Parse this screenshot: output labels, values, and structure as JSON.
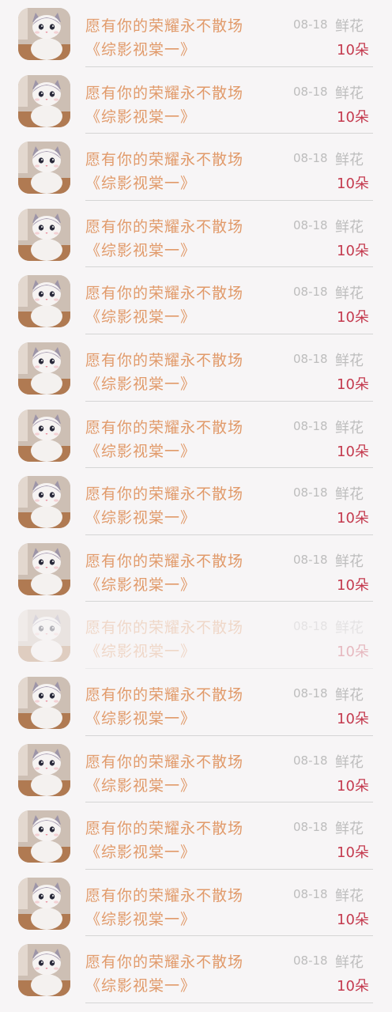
{
  "items": [
    {
      "title": "愿有你的荣耀永不散场",
      "subtitle": "《综影视棠一》",
      "date": "08-18",
      "gift": "鲜花",
      "count": "10朵",
      "avatar_icon": "kitten-avatar-icon",
      "faded": false
    },
    {
      "title": "愿有你的荣耀永不散场",
      "subtitle": "《综影视棠一》",
      "date": "08-18",
      "gift": "鲜花",
      "count": "10朵",
      "avatar_icon": "kitten-avatar-icon",
      "faded": false
    },
    {
      "title": "愿有你的荣耀永不散场",
      "subtitle": "《综影视棠一》",
      "date": "08-18",
      "gift": "鲜花",
      "count": "10朵",
      "avatar_icon": "kitten-avatar-icon",
      "faded": false
    },
    {
      "title": "愿有你的荣耀永不散场",
      "subtitle": "《综影视棠一》",
      "date": "08-18",
      "gift": "鲜花",
      "count": "10朵",
      "avatar_icon": "kitten-avatar-icon",
      "faded": false
    },
    {
      "title": "愿有你的荣耀永不散场",
      "subtitle": "《综影视棠一》",
      "date": "08-18",
      "gift": "鲜花",
      "count": "10朵",
      "avatar_icon": "kitten-avatar-icon",
      "faded": false
    },
    {
      "title": "愿有你的荣耀永不散场",
      "subtitle": "《综影视棠一》",
      "date": "08-18",
      "gift": "鲜花",
      "count": "10朵",
      "avatar_icon": "kitten-avatar-icon",
      "faded": false
    },
    {
      "title": "愿有你的荣耀永不散场",
      "subtitle": "《综影视棠一》",
      "date": "08-18",
      "gift": "鲜花",
      "count": "10朵",
      "avatar_icon": "kitten-avatar-icon",
      "faded": false
    },
    {
      "title": "愿有你的荣耀永不散场",
      "subtitle": "《综影视棠一》",
      "date": "08-18",
      "gift": "鲜花",
      "count": "10朵",
      "avatar_icon": "kitten-avatar-icon",
      "faded": false
    },
    {
      "title": "愿有你的荣耀永不散场",
      "subtitle": "《综影视棠一》",
      "date": "08-18",
      "gift": "鲜花",
      "count": "10朵",
      "avatar_icon": "kitten-avatar-icon",
      "faded": false
    },
    {
      "title": "愿有你的荣耀永不散场",
      "subtitle": "《综影视棠一》",
      "date": "08-18",
      "gift": "鲜花",
      "count": "10朵",
      "avatar_icon": "kitten-avatar-icon",
      "faded": true
    },
    {
      "title": "愿有你的荣耀永不散场",
      "subtitle": "《综影视棠一》",
      "date": "08-18",
      "gift": "鲜花",
      "count": "10朵",
      "avatar_icon": "kitten-avatar-icon",
      "faded": false
    },
    {
      "title": "愿有你的荣耀永不散场",
      "subtitle": "《综影视棠一》",
      "date": "08-18",
      "gift": "鲜花",
      "count": "10朵",
      "avatar_icon": "kitten-avatar-icon",
      "faded": false
    },
    {
      "title": "愿有你的荣耀永不散场",
      "subtitle": "《综影视棠一》",
      "date": "08-18",
      "gift": "鲜花",
      "count": "10朵",
      "avatar_icon": "kitten-avatar-icon",
      "faded": false
    },
    {
      "title": "愿有你的荣耀永不散场",
      "subtitle": "《综影视棠一》",
      "date": "08-18",
      "gift": "鲜花",
      "count": "10朵",
      "avatar_icon": "kitten-avatar-icon",
      "faded": false
    },
    {
      "title": "愿有你的荣耀永不散场",
      "subtitle": "《综影视棠一》",
      "date": "08-18",
      "gift": "鲜花",
      "count": "10朵",
      "avatar_icon": "kitten-avatar-icon",
      "faded": false
    }
  ],
  "colors": {
    "background": "#f7f5f6",
    "title_text": "#e19a6a",
    "meta_text": "#bdbdbd",
    "count_text": "#c43a4e",
    "divider": "#d5d5d5"
  }
}
